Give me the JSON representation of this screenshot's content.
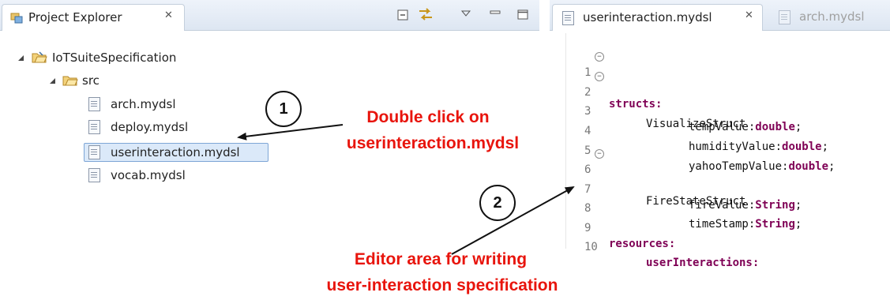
{
  "project_explorer": {
    "tab_title": "Project Explorer",
    "tab_close": "✕",
    "toolbar": [
      "collapse-all-icon",
      "link-with-editor-icon",
      "view-menu-icon",
      "minimize-icon",
      "maximize-icon"
    ],
    "tree": {
      "project": "IoTSuiteSpecification",
      "folder": "src",
      "files": [
        "arch.mydsl",
        "deploy.mydsl",
        "userinteraction.mydsl",
        "vocab.mydsl"
      ],
      "selected_file": "userinteraction.mydsl"
    }
  },
  "editor": {
    "active_tab": "userinteraction.mydsl",
    "active_tab_close": "✕",
    "inactive_tab": "arch.mydsl",
    "lines": [
      {
        "num": "1",
        "fold": "−",
        "kw": "structs:",
        "pre": "",
        "post": ""
      },
      {
        "num": "2",
        "fold": "−",
        "kw": "",
        "pre": "VisualizeStruct",
        "post": ""
      },
      {
        "num": "3",
        "fold": "",
        "kw": "double",
        "pre": "tempValue:",
        "post": ";"
      },
      {
        "num": "4",
        "fold": "",
        "kw": "double",
        "pre": "humidityValue:",
        "post": ";"
      },
      {
        "num": "5",
        "fold": "",
        "kw": "double",
        "pre": "yahooTempValue:",
        "post": ";"
      },
      {
        "num": "6",
        "fold": "−",
        "kw": "",
        "pre": "FireStateStruct",
        "post": ""
      },
      {
        "num": "7",
        "fold": "",
        "kw": "String",
        "pre": "fireValue:",
        "post": ";"
      },
      {
        "num": "8",
        "fold": "",
        "kw": "String",
        "pre": "timeStamp:",
        "post": ";"
      },
      {
        "num": "9",
        "fold": "",
        "kw": "resources:",
        "pre": "",
        "post": ""
      },
      {
        "num": "10",
        "fold": "",
        "kw": "userInteractions:",
        "pre": "",
        "post": ""
      }
    ]
  },
  "annotations": {
    "step1_number": "1",
    "step1_line1": "Double click on",
    "step1_line2": "userinteraction.mydsl",
    "step2_number": "2",
    "step2_line1": "Editor area for writing",
    "step2_line2": "user-interaction  specification",
    "text_color": "#e8140c"
  }
}
